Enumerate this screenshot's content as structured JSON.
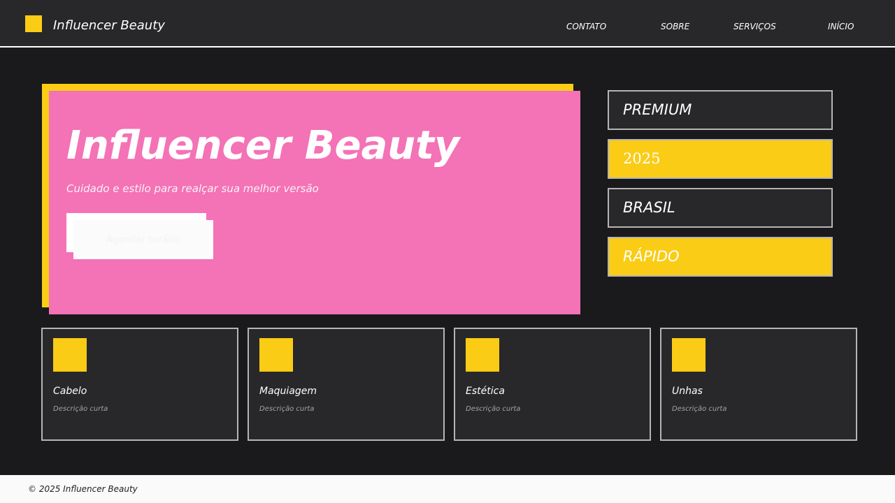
{
  "header": {
    "brand": "Influencer Beauty",
    "nav": [
      "CONTATO",
      "SOBRE",
      "SERVIÇOS",
      "INÍCIO"
    ]
  },
  "hero": {
    "title": "Influencer Beauty",
    "subtitle": "Cuidado e estilo para realçar sua melhor versão",
    "cta_label": "Agendar horário"
  },
  "tags": [
    "PREMIUM",
    "2025",
    "BRASIL",
    "RÁPIDO"
  ],
  "cards": [
    {
      "title": "Cabelo",
      "desc": "Descrição curta"
    },
    {
      "title": "Maquiagem",
      "desc": "Descrição curta"
    },
    {
      "title": "Estética",
      "desc": "Descrição curta"
    },
    {
      "title": "Unhas",
      "desc": "Descrição curta"
    }
  ],
  "footer": {
    "text": "© 2025 Influencer Beauty"
  },
  "colors": {
    "accent_yellow": "#facc15",
    "hero_pink": "#f472b6",
    "background": "#1a1a1c",
    "panel": "#28282a"
  },
  "icons": {
    "logo": "brand-square-icon",
    "card": "service-square-icon"
  }
}
